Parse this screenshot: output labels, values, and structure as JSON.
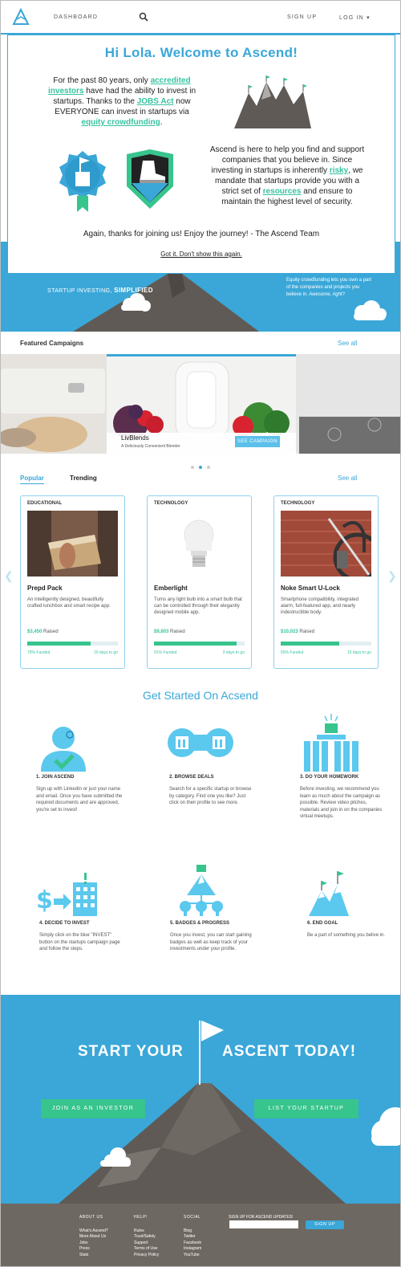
{
  "header": {
    "nav_dashboard": "DASHBOARD",
    "sign_up": "SIGN UP",
    "log_in": "LOG IN"
  },
  "hero": {
    "tagline_prefix": "STARTUP INVESTING,",
    "tagline_emphasis": "SIMPLIFIED",
    "right_text": "Equity crowdfunding lets you own a part of the companies and projects you believe in. Awesome, right?"
  },
  "modal": {
    "title": "Hi Lola.  Welcome to Ascend!",
    "p1_a": "For the past 80 years, only ",
    "p1_link1": "accredited investors",
    "p1_b": " have had the ability to invest in startups. Thanks to the ",
    "p1_link2": "JOBS Act",
    "p1_c": " now EVERYONE can invest in startups via ",
    "p1_link3": "equity crowdfunding",
    "p1_d": ".",
    "p2_a": "Ascend is here to help you find and support companies that you believe in. Since investing in startups is inherently ",
    "p2_link1": "risky",
    "p2_b": ", we mandate that startups provide you with a strict set of ",
    "p2_link2": "resources",
    "p2_c": " and ensure to maintain the highest level of security.",
    "thanks": "Again, thanks for joining us!  Enjoy the journey! - The Ascend Team",
    "dismiss": "Got it. Don't show this again."
  },
  "featured": {
    "heading": "Featured Campaigns",
    "see_all": "See all",
    "slide_name": "LivBlends",
    "slide_sub": "A Deliciously Convenient Blender",
    "slide_button": "SEE CAMPAIGN"
  },
  "tabs": {
    "popular": "Popular",
    "trending": "Trending",
    "see_all": "See all"
  },
  "cards": [
    {
      "category": "EDUCATIONAL",
      "name": "Prepd Pack",
      "desc": "An intelligently designed, beautifully crafted lunchbox and smart recipe app.",
      "raised": "$3,450",
      "raised_label": "Raised",
      "funded": "70% Funded",
      "funded_pct": 70,
      "days": "10 days to go"
    },
    {
      "category": "TECHNOLOGY",
      "name": "Emberlight",
      "desc": "Turns any light bulb into a smart bulb that can be controlled through their elegantly designed mobile app.",
      "raised": "$9,603",
      "raised_label": "Raised",
      "funded": "91% Funded",
      "funded_pct": 91,
      "days": "2 days to go"
    },
    {
      "category": "TECHNOLOGY",
      "name": "Noke Smart U-Lock",
      "desc": "Smartphone compatibility, integrated alarm, full-featured app, and nearly indestructible body.",
      "raised": "$10,023",
      "raised_label": "Raised",
      "funded": "65% Funded",
      "funded_pct": 65,
      "days": "15 days to go"
    }
  ],
  "get_started": {
    "title": "Get Started On Acsend",
    "steps": [
      {
        "head": "1. JOIN ASCEND",
        "desc": "Sign up with LinkedIn or just your name and email. Once you have submitted the required documents and are approved, you're set to invest!",
        "icon": "user-check-icon"
      },
      {
        "head": "2. BROWSE DEALS",
        "desc": "Search for a specific startup or browse by category. Find one you like?  Just click on their profile to see more.",
        "icon": "binoculars-icon"
      },
      {
        "head": "3. DO YOUR HOMEWORK",
        "desc": "Before investing, we recommend you learn as much about the campaign as possible. Review video pitches, materials and join in on the companies virtual meetups.",
        "icon": "books-icon"
      },
      {
        "head": "4. DECIDE TO INVEST",
        "desc": "Simply click on the blue \"INVEST\" button on the startups campaign page and follow the steps.",
        "icon": "dollar-building-icon"
      },
      {
        "head": "5. BADGES & PROGRESS",
        "desc": "Once you invest, you can start gaining badges as well as keep track of your investments under your profile.",
        "icon": "badge-tree-icon"
      },
      {
        "head": "6. END GOAL",
        "desc": "Be a part of something you belive in.",
        "icon": "mountain-flag-icon"
      }
    ]
  },
  "cta": {
    "left": "START YOUR",
    "right": "ASCENT TODAY!",
    "investor_btn": "JOIN AS AN INVESTOR",
    "startup_btn": "LIST YOUR STARTUP"
  },
  "footer": {
    "about_head": "ABOUT US",
    "about": [
      "What's Ascend?",
      "More About Us",
      "Jobs",
      "Press",
      "Stats"
    ],
    "help_head": "HELP!",
    "help": [
      "Rules",
      "Trust/Safety",
      "Support",
      "Terms of Use",
      "Privacy Policy"
    ],
    "social_head": "SOCIAL",
    "social": [
      "Blog",
      "Twitter",
      "Facebook",
      "Instagram",
      "YouTube"
    ],
    "signup_head": "SIGN UP FOR ASCEND UPDATES!",
    "signup_btn": "SIGN UP"
  },
  "colors": {
    "brand_blue": "#3aa7d8",
    "accent_green": "#37c48d",
    "link_green": "#37c3a0",
    "mountain_grey": "#5f5a55",
    "footer_grey": "#6e6862"
  }
}
